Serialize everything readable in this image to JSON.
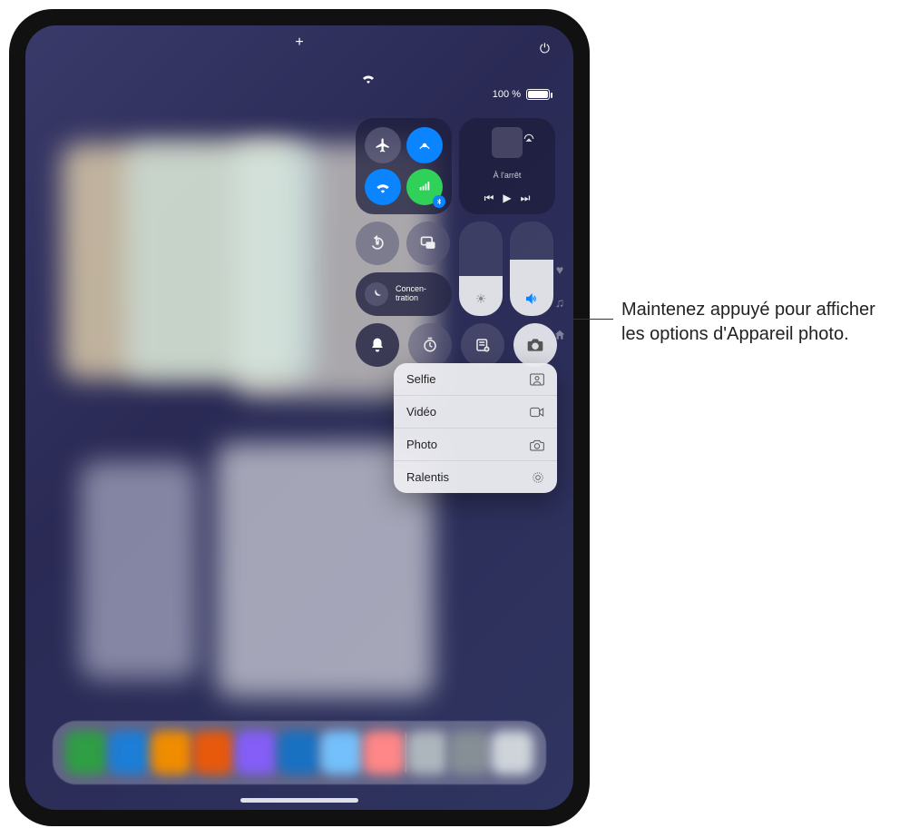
{
  "status": {
    "battery_text": "100 %"
  },
  "media": {
    "status": "À l'arrêt"
  },
  "focus": {
    "label": "Concen-\ntration"
  },
  "camera_menu": {
    "items": [
      {
        "label": "Selfie",
        "icon": "person-rect"
      },
      {
        "label": "Vidéo",
        "icon": "video"
      },
      {
        "label": "Photo",
        "icon": "camera"
      },
      {
        "label": "Ralentis",
        "icon": "slowmo"
      }
    ]
  },
  "callout": {
    "text": "Maintenez appuyé pour afficher les options d'Appareil photo."
  },
  "sliders": {
    "brightness_pct": 42,
    "volume_pct": 60
  },
  "dock_colors": [
    "#2f9e44",
    "#1c7ed6",
    "#f08c00",
    "#e8590c",
    "#845ef7",
    "#1971c2",
    "#74c0fc",
    "#ff8787",
    "#adb5bd",
    "#868e96",
    "#ced4da"
  ]
}
